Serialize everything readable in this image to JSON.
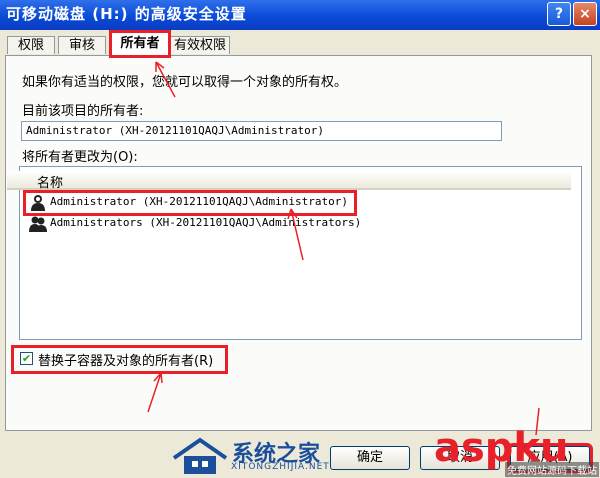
{
  "window": {
    "title": "可移动磁盘 (H:) 的高级安全设置",
    "help_label": "?",
    "close_label": "×"
  },
  "tabs": [
    {
      "label": "权限"
    },
    {
      "label": "审核"
    },
    {
      "label": "所有者",
      "active": true
    },
    {
      "label": "有效权限"
    }
  ],
  "owner_tab": {
    "intro": "如果你有适当的权限，您就可以取得一个对象的所有权。",
    "current_owner_label": "目前该项目的所有者:",
    "current_owner_value": "Administrator (XH-20121101QAQJ\\Administrator)",
    "change_to_label": "将所有者更改为(O):",
    "list_header": "名称",
    "owners": [
      {
        "name": "Administrator (XH-20121101QAQJ\\Administrator)",
        "highlighted": true
      },
      {
        "name": "Administrators (XH-20121101QAQJ\\Administrators)",
        "highlighted": false
      }
    ],
    "replace_checkbox_label": "替换子容器及对象的所有者(R)",
    "replace_checked": true
  },
  "buttons": {
    "ok": "确定",
    "cancel": "取消",
    "apply": "应用(A)"
  },
  "watermark": {
    "site_name": "系统之家",
    "site_url": "XITONGZHIJIA.NET",
    "brand": "aspku",
    "small_text": "免费网站源码下载站"
  },
  "colors": {
    "title_bar": "#0a4bd8",
    "highlight": "#e8202a"
  }
}
